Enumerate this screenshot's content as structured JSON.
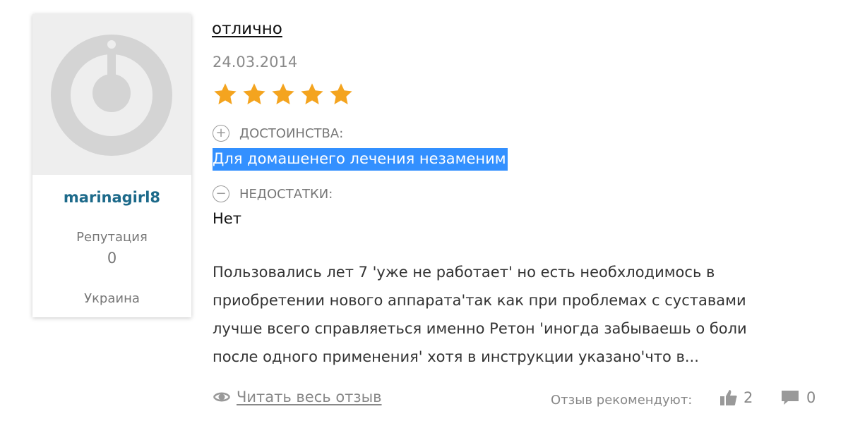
{
  "user": {
    "name": "marinagirl8",
    "reputation_label": "Репутация",
    "reputation_value": "0",
    "country": "Украина"
  },
  "review": {
    "title": "отлично",
    "date": "24.03.2014",
    "rating": 5,
    "rating_max": 5,
    "pros_label": "ДОСТОИНСТВА:",
    "pros_text": "Для домашенего лечения незаменим",
    "cons_label": "НЕДОСТАТКИ:",
    "cons_text": "Нет",
    "body": "Пользовались лет 7 'уже не работает' но есть необхлодимось в приобретении нового аппарата'так как при проблемах с суставами лучше всего справляеться именно Ретон 'иногда забываешь о боли после одного применения' хотя в инструкции указано'что в..."
  },
  "footer": {
    "read_more": "Читать весь отзыв",
    "recommend_label": "Отзыв рекомендуют:",
    "likes": "2",
    "comments": "0"
  },
  "icons": {
    "eye": "eye-icon",
    "thumbs_up": "thumbs-up-icon",
    "comment": "comment-icon",
    "plus_circle": "plus-circle-icon",
    "minus_circle": "minus-circle-icon",
    "avatar_placeholder": "avatar-placeholder-icon"
  },
  "colors": {
    "star": "#f4a41f",
    "username": "#1d6a8a",
    "highlight": "#3390ff"
  }
}
